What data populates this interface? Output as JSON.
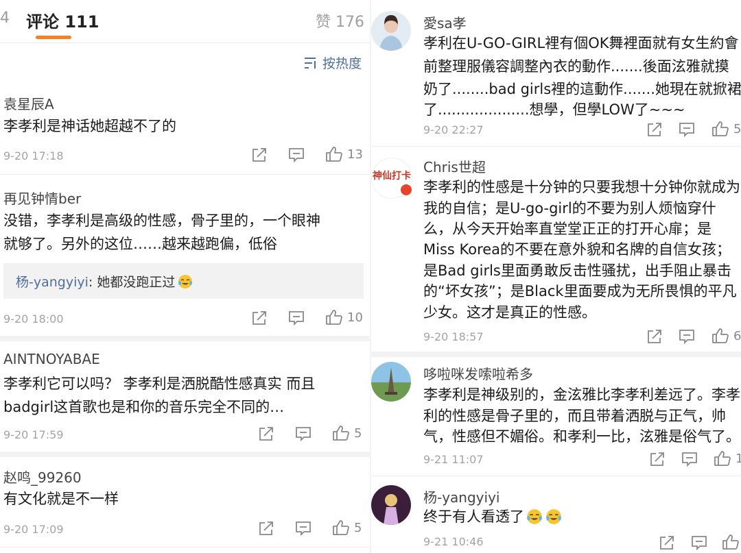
{
  "header": {
    "left_stub": "4",
    "comments_tab": "评论 111",
    "likes_tab": "赞 176",
    "sort_label": "按热度",
    "accent_color": "#f5821f"
  },
  "left_comments": [
    {
      "user": "袁星辰A",
      "lines": [
        "李孝利是神话她超越不了的"
      ],
      "time": "9-20 17:18",
      "likes": "13"
    },
    {
      "user": "再见钟情ber",
      "lines": [
        "没错，李孝利是高级的性感，骨子里的，一个眼神",
        "就够了。另外的这位……越来越跑偏，低俗"
      ],
      "reply_user": "杨-yangyiyi",
      "reply_text": ": 她都没跑正过",
      "time": "9-20 18:00",
      "likes": "10"
    },
    {
      "user": "AINTNOYABAE",
      "lines": [
        "李孝利它可以吗？ 李孝利是洒脱酷性感真实 而且",
        "badgirl这首歌也是和你的音乐完全不同的…"
      ],
      "time": "9-20 17:59",
      "likes": "5"
    },
    {
      "user": "赵鸣_99260",
      "lines": [
        "有文化就是不一样"
      ],
      "time": "9-20 17:09",
      "likes": "5"
    }
  ],
  "right_comments": [
    {
      "user": "愛sa孝",
      "lines": [
        "孝利在U-GO-GIRL裡有個OK舞裡面就有女生約會",
        "前整理服儀容調整內衣的動作.......後面泫雅就摸",
        "奶了........bad girls裡的這動作.......她現在就掀裙",
        "了....................想學，但學LOW了~~~"
      ],
      "time": "9-20 22:27",
      "likes": "5"
    },
    {
      "user": "Chris世超",
      "lines": [
        "李孝利的性感是十分钟的只要我想十分钟你就成为",
        "我的自信；是U-go-girl的不要为别人烦恼穿什",
        "么，从今天开始率直堂堂正正的打开心扉；是",
        "Miss Korea的不要在意外貌和名牌的自信女孩；",
        "是Bad girls里面勇敢反击性骚扰，出手阻止暴击",
        "的“坏女孩”；是Black里面要成为无所畏惧的平凡",
        "少女。这才是真正的性感。"
      ],
      "time": "9-20 18:57",
      "likes": "6"
    },
    {
      "user": "哆啦咪发嗦啦希多",
      "lines": [
        "李孝利是神级别的，金泫雅比李孝利差远了。李孝",
        "利的性感是骨子里的，而且带着洒脱与正气，帅",
        "气，性感但不媚俗。和孝利一比，泫雅是俗气了。"
      ],
      "time": "9-21 11:07",
      "likes": "1"
    },
    {
      "user": "杨-yangyiyi",
      "lines": [
        "终于有人看透了"
      ],
      "time": "9-21 10:46",
      "likes": ""
    }
  ],
  "avatar_badge_text": "神仙打卡",
  "icons": {
    "share": "share-icon",
    "comment": "comment-icon",
    "like": "thumbs-up-icon",
    "sort": "sort-icon",
    "emoji": "laughing-crying-emoji-icon"
  }
}
